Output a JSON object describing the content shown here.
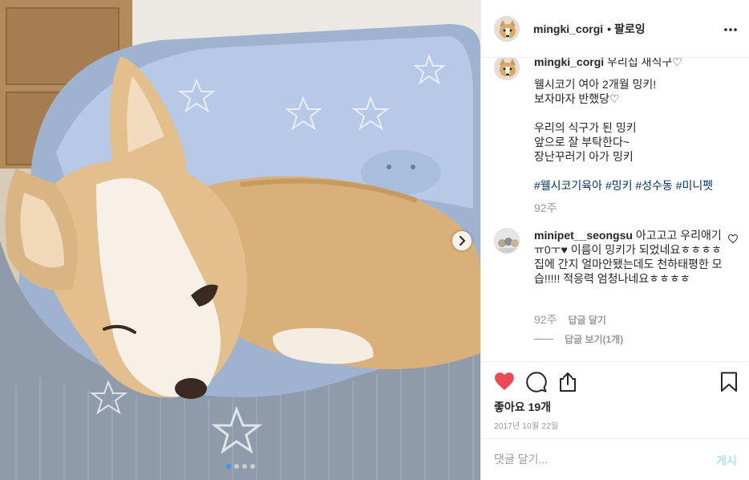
{
  "post": {
    "username": "mingki_corgi",
    "follow_separator": "•",
    "follow_label": "팔로잉",
    "more_icon": "more-horizontal-icon"
  },
  "caption": {
    "username": "mingki_corgi",
    "first_line": "우리집 새식구♡",
    "lines": [
      "웰시코기 여아 2개월 밍키!",
      "보자마자 반했당♡",
      "",
      "우리의 식구가 된 밍키",
      "앞으로 잘 부탁한다~",
      "장난꾸러기 아가 밍키",
      ""
    ],
    "hashtags": "#웰시코기육아 #밍키 #성수동 #미니펫",
    "age": "92주"
  },
  "comment": {
    "username": "minipet__seongsu",
    "text": "아고고고 우리애기ㅠ0ㅜ♥ 이름이 밍키가 되었네요ㅎㅎㅎㅎ 집에 간지 얼마안됐는데도 천하태평한 모습!!!!! 적응력 엄청나네요ㅎㅎㅎㅎ",
    "age": "92주",
    "reply_label": "답글 달기",
    "view_replies": "답글 보기(1개)"
  },
  "actions": {
    "like_icon": "heart-filled-icon",
    "comment_icon": "comment-icon",
    "share_icon": "share-icon",
    "save_icon": "bookmark-icon",
    "likes": "좋아요 19개",
    "date": "2017년 10월 22일"
  },
  "add_comment": {
    "placeholder": "댓글 달기...",
    "post_label": "게시"
  },
  "carousel": {
    "total_slides": 4,
    "active_slide": 1,
    "next_icon": "chevron-right-icon"
  },
  "colors": {
    "like_red": "#ed4956",
    "hashtag_blue": "#003569",
    "active_dot": "#3897f0",
    "post_button_disabled": "#b2dffc"
  }
}
